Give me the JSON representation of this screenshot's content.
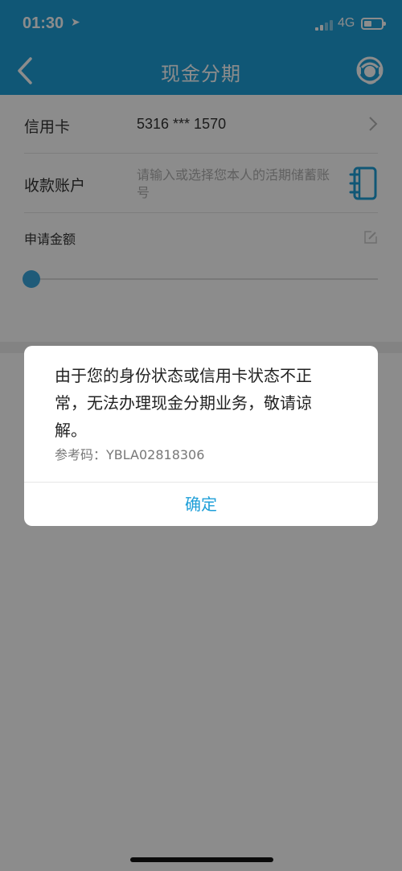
{
  "status_bar": {
    "time": "01:30",
    "network": "4G"
  },
  "nav": {
    "title": "现金分期"
  },
  "form": {
    "card_label": "信用卡",
    "card_number": "5316 *** 1570",
    "account_label": "收款账户",
    "account_placeholder": "请输入或选择您本人的活期储蓄账号",
    "amount_label": "申请金额"
  },
  "dialog": {
    "message": "由于您的身份状态或信用卡状态不正常，无法办理现金分期业务，敬请谅解。",
    "reference": "参考码：YBLA02818306",
    "confirm_label": "确定"
  },
  "icons": {
    "back": "chevron-left-icon",
    "service": "customer-service-icon",
    "card_chevron": "chevron-right-icon",
    "account_book": "address-book-icon",
    "amount_edit": "edit-icon"
  },
  "colors": {
    "brand": "#1e9fd8",
    "slider_knob": "#3aa7dc"
  }
}
